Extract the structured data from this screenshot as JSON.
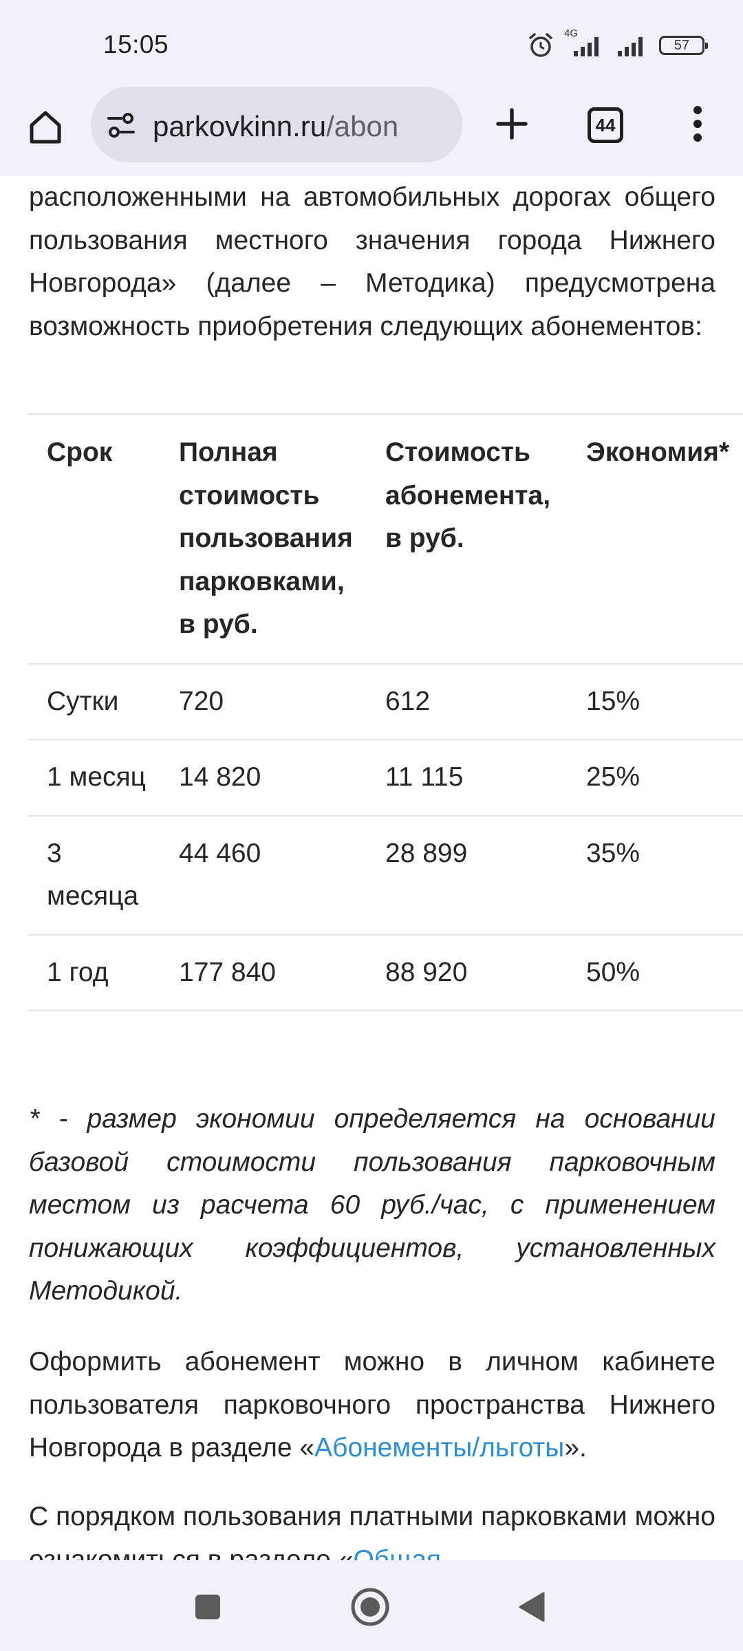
{
  "status_bar": {
    "time": "15:05",
    "network_label": "4G",
    "battery": "57",
    "icons": [
      "alarm-icon",
      "signal-icon",
      "signal-icon",
      "battery-icon"
    ]
  },
  "browser": {
    "url_domain": "parkovkinn.ru",
    "url_path": "/abon",
    "tab_count": "44",
    "icons": [
      "home-icon",
      "tune-icon",
      "plus-icon",
      "more-vert-icon"
    ]
  },
  "content": {
    "intro": "расположенными на автомобильных дорогах общего пользования местного значения города Нижнего Новгорода» (далее – Методика) предусмотрена возможность приобретения следующих абонементов:",
    "table": {
      "headers": [
        "Срок",
        "Полная стоимость пользования парковками, в руб.",
        "Стоимость абонемента, в руб.",
        "Экономия*"
      ],
      "rows": [
        [
          "Сутки",
          "720",
          "612",
          "15%"
        ],
        [
          "1 месяц",
          "14 820",
          "11 115",
          "25%"
        ],
        [
          "3 месяца",
          "44 460",
          "28 899",
          "35%"
        ],
        [
          "1 год",
          "177 840",
          "88 920",
          "50%"
        ]
      ]
    },
    "note": "* - размер экономии определяется на основании базовой стоимости пользования парковочным местом из расчета 60 руб./час, с применением понижающих коэффициентов, установленных Методикой.",
    "para1_before": "Оформить абонемент можно в личном кабинете пользователя парковочного пространства Нижнего Новгорода в разделе «",
    "para1_link": "Абонементы/льготы",
    "para1_after": "».",
    "para2_before": "С порядком пользования платными парковками можно ознакомиться в разделе «",
    "para2_link": "Общая"
  },
  "colors": {
    "link": "#2c8fd6",
    "chrome_background": "#f2f1f9",
    "url_bar": "#e0dfea"
  },
  "nav_bar": {
    "icons": [
      "recents-icon",
      "home-circle-icon",
      "back-icon"
    ]
  }
}
